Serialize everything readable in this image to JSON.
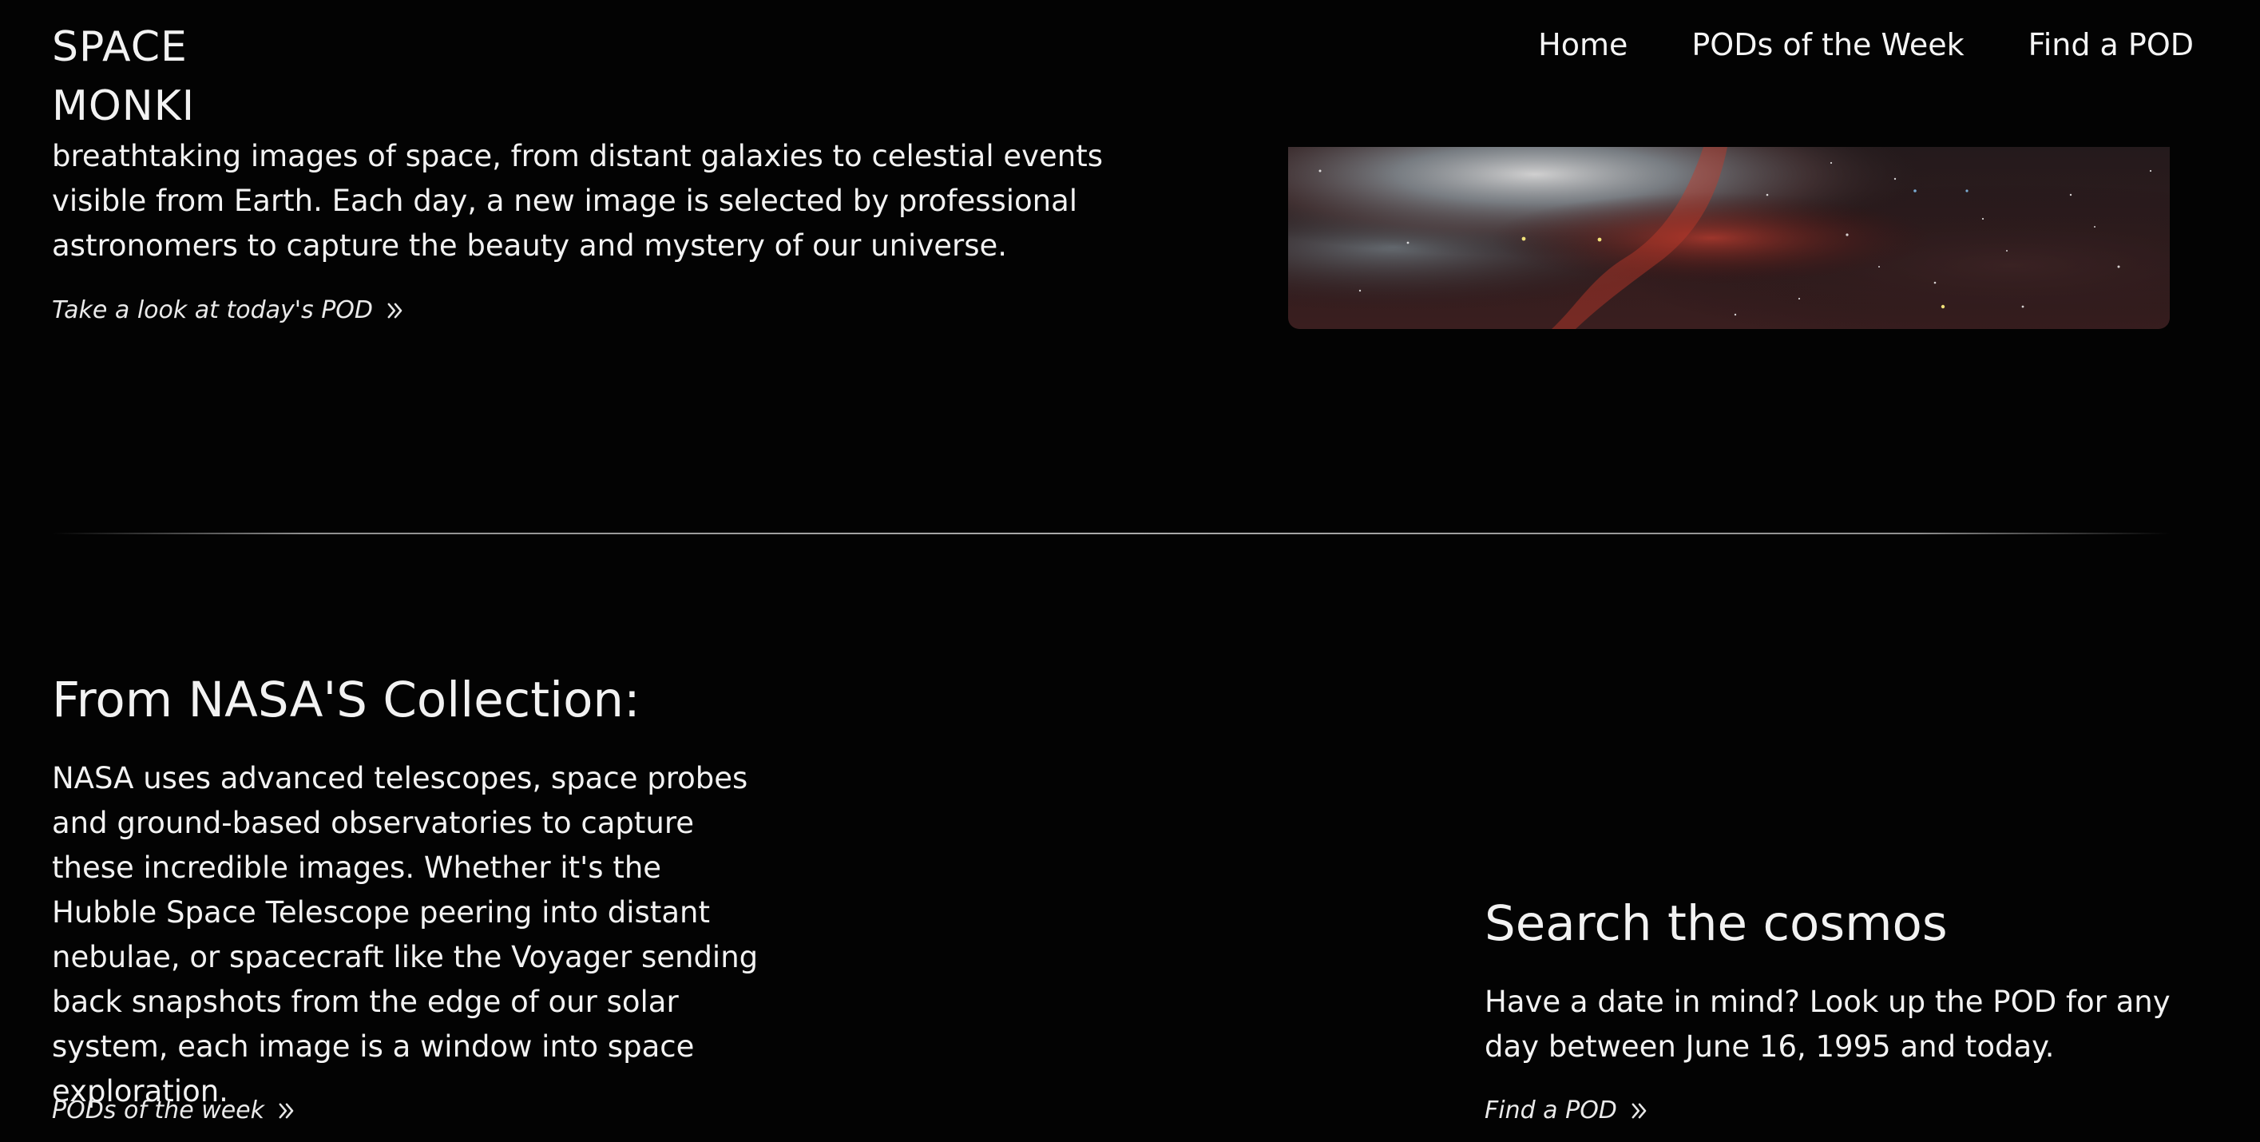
{
  "brand": {
    "line1": "SPACE",
    "line2": "MONKI"
  },
  "nav": {
    "items": [
      "Home",
      "PODs of the Week",
      "Find a POD"
    ]
  },
  "intro": {
    "paragraph": "breathtaking images of space, from distant galaxies to celestial events visible from Earth. Each day, a new image is selected by professional astronomers to capture the beauty and mystery of our universe.",
    "cta_label": "Take a look at today's POD",
    "image_icon": "nebula-image"
  },
  "nasa_section": {
    "title": "From NASA'S Collection:",
    "paragraph": "NASA uses advanced telescopes, space probes and ground-based observatories to capture these incredible images. Whether it's the Hubble Space Telescope peering into distant nebulae, or spacecraft like the Voyager sending back snapshots from the edge of our solar system, each image is a window into space exploration.",
    "cta_label": "PODs of the week"
  },
  "search_section": {
    "title": "Search the cosmos",
    "paragraph": "Have a date in mind? Look up the POD for any day between June 16, 1995 and today.",
    "cta_label": "Find a POD"
  },
  "icons": {
    "cta_arrow": "double-chevron-right-icon"
  },
  "colors": {
    "background": "#030303",
    "text": "#f2f2f2"
  }
}
